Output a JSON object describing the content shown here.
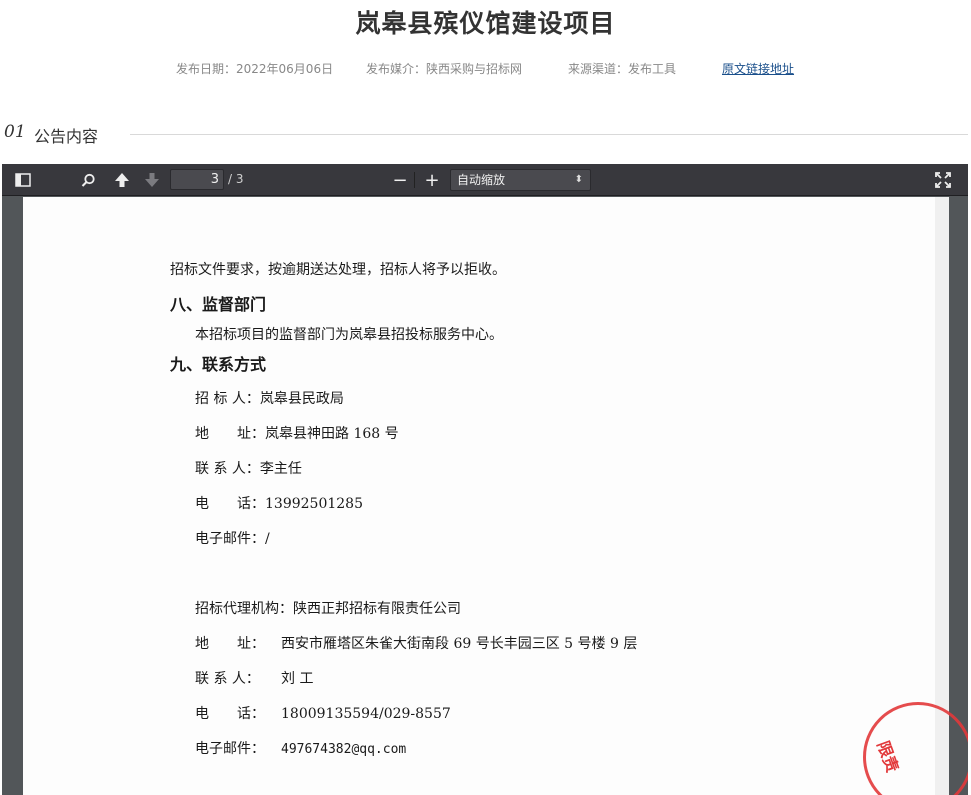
{
  "header": {
    "title": "岚皋县殡仪馆建设项目",
    "publish_date": "发布日期：2022年06月06日",
    "publish_media": "发布媒介：陕西采购与招标网",
    "source_channel": "来源渠道：发布工具",
    "original_link": "原文链接地址"
  },
  "section": {
    "number": "01",
    "label": "公告内容"
  },
  "viewer": {
    "current_page": "3",
    "total_pages": "/ 3",
    "zoom": "自动缩放",
    "zoom_out": "−",
    "zoom_in": "+",
    "icons": {
      "sidebar": "sidebar-toggle-icon",
      "search": "search-icon",
      "prev": "arrow-up-icon",
      "next": "arrow-down-icon",
      "fullscreen": "fullscreen-icon"
    }
  },
  "document": {
    "line_intro": "招标文件要求，按逾期送达处理，招标人将予以拒收。",
    "heading_8": "八、监督部门",
    "line_8": "本招标项目的监督部门为岚皋县招投标服务中心。",
    "heading_9": "九、联系方式",
    "tenderer": {
      "name_key": "招 标 人：",
      "name_val": "岚皋县民政局",
      "addr_key": "地　　址：",
      "addr_val": "岚皋县神田路 168 号",
      "contact_key": "联 系 人：",
      "contact_val": "李主任",
      "phone_key": "电　　话：",
      "phone_val": "13992501285",
      "email_key": "电子邮件：",
      "email_val": "/"
    },
    "agency": {
      "name_key": "招标代理机构：",
      "name_val": "陕西正邦招标有限责任公司",
      "addr_key": "地　　址：",
      "addr_val": "西安市雁塔区朱雀大街南段 69 号长丰园三区 5 号楼 9 层",
      "contact_key": "联 系 人：",
      "contact_val": "刘 工",
      "phone_key": "电　　话：",
      "phone_val": "18009135594/029-8557",
      "email_key": "电子邮件：",
      "email_val": "497674382@qq.com"
    },
    "stamp_text": "限责"
  },
  "colors": {
    "toolbar": "#38383d",
    "viewer_bg": "#525659",
    "link": "#1a4f8b",
    "stamp": "#e2383a"
  }
}
